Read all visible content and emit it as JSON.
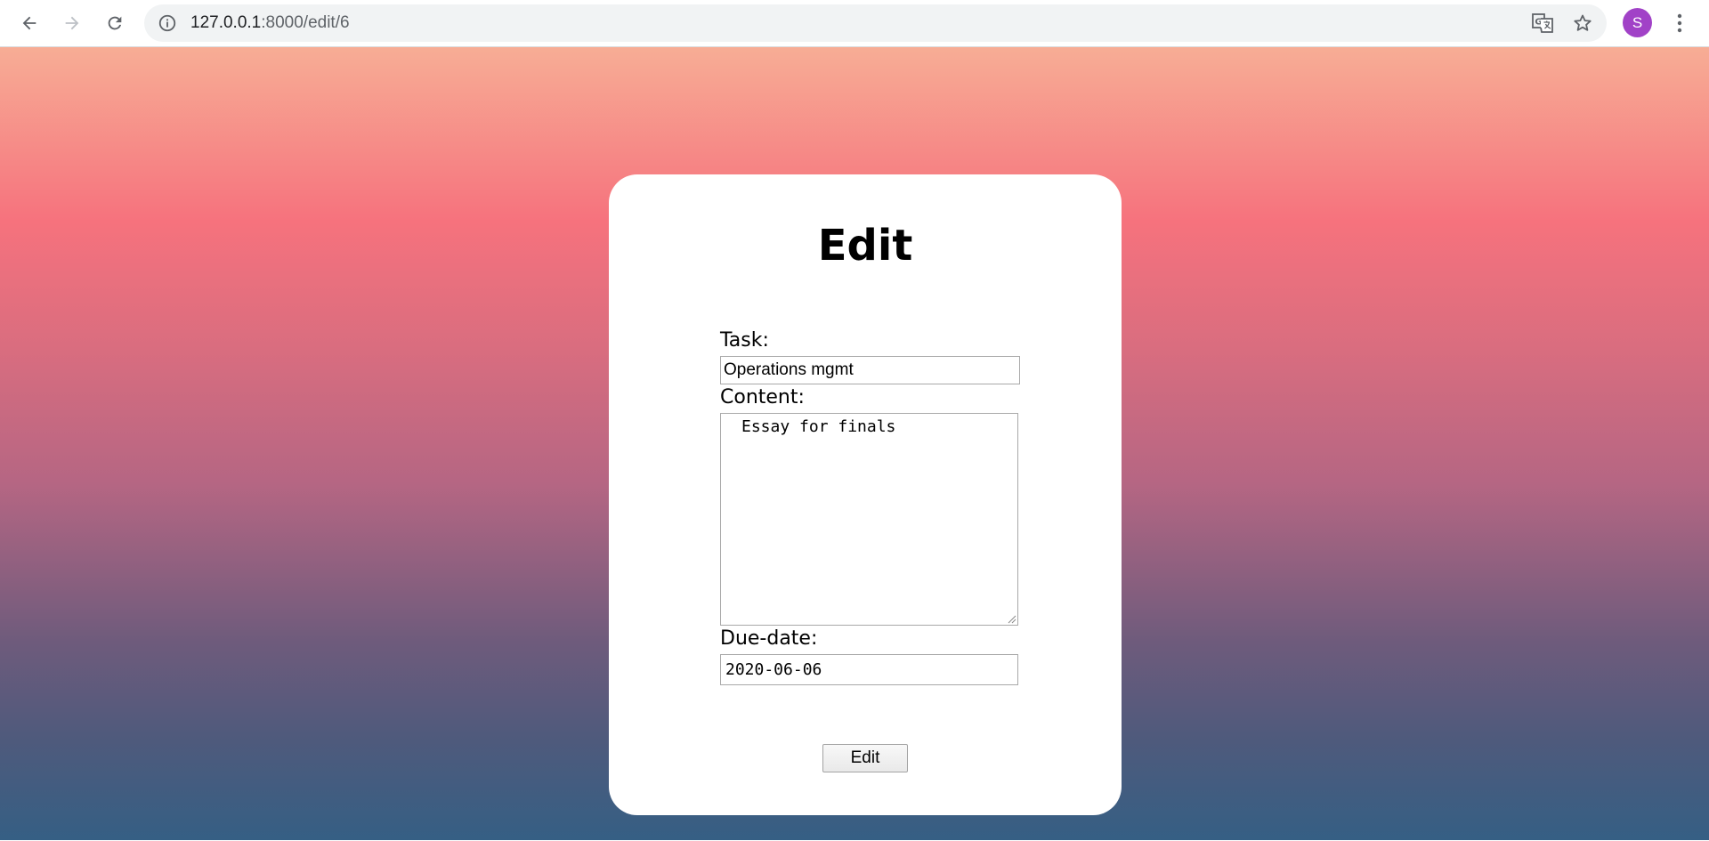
{
  "browser": {
    "url_host": "127.0.0.1",
    "url_path": ":8000/edit/6",
    "profile_initial": "S",
    "colors": {
      "profile_avatar": "#a142c7",
      "omnibox_bg": "#f1f3f4"
    },
    "icons": [
      "back-arrow-icon",
      "forward-arrow-icon",
      "reload-icon",
      "info-icon",
      "translate-icon",
      "star-icon",
      "kebab-menu-icon"
    ]
  },
  "form": {
    "title": "Edit",
    "task_label": "Task:",
    "task_value": "Operations mgmt",
    "content_label": "Content:",
    "content_value": "Essay for finals",
    "due_label": "Due-date:",
    "due_value": "2020-06-06",
    "submit_label": "Edit"
  }
}
